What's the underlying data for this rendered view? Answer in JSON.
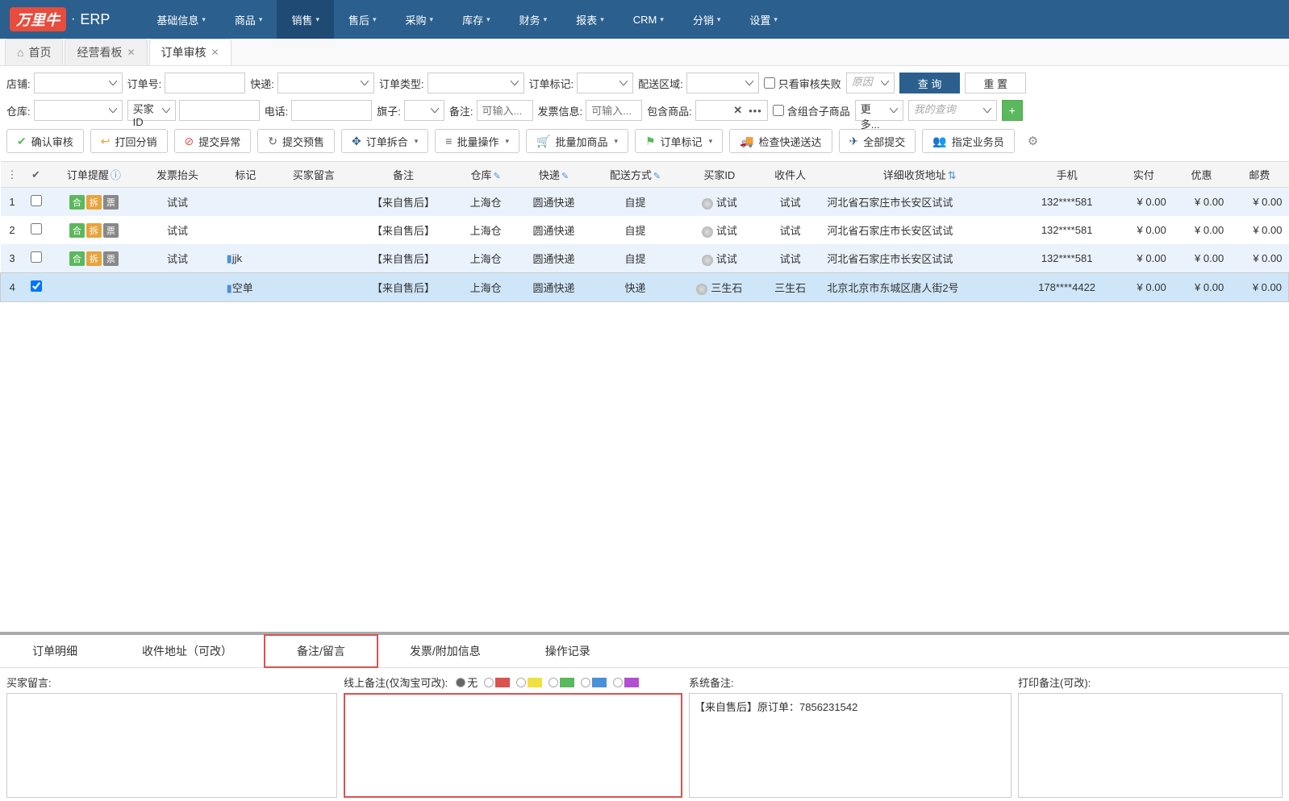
{
  "brand": {
    "logo": "万里牛",
    "suffix": "ERP"
  },
  "nav": [
    "基础信息",
    "商品",
    "销售",
    "售后",
    "采购",
    "库存",
    "财务",
    "报表",
    "CRM",
    "分销",
    "设置"
  ],
  "nav_active_index": 2,
  "tabs": {
    "home": "首页",
    "t1": "经营看板",
    "t2": "订单审核"
  },
  "filters": {
    "row1": {
      "shop": "店铺:",
      "order_no": "订单号:",
      "express": "快递:",
      "order_type": "订单类型:",
      "order_mark": "订单标记:",
      "delivery_area": "配送区域:",
      "only_fail": "只看审核失败",
      "reason_ph": "原因",
      "query": "查 询",
      "reset": "重 置"
    },
    "row2": {
      "warehouse": "仓库:",
      "buyer_id": "买家ID",
      "phone": "电话:",
      "flag": "旗子:",
      "remark": "备注:",
      "remark_ph": "可输入...",
      "invoice": "发票信息:",
      "invoice_ph": "可输入...",
      "include_goods": "包含商品:",
      "combo": "含组合子商品",
      "more": "更 多...",
      "my_query_ph": "我的查询"
    }
  },
  "toolbar": [
    {
      "icon": "✔",
      "cls": "ico-green",
      "label": "确认审核"
    },
    {
      "icon": "↩",
      "cls": "ico-orange",
      "label": "打回分销"
    },
    {
      "icon": "⊘",
      "cls": "ico-red",
      "label": "提交异常"
    },
    {
      "icon": "↻",
      "cls": "ico-gray",
      "label": "提交预售"
    },
    {
      "icon": "✥",
      "cls": "ico-blue",
      "label": "订单拆合",
      "caret": true
    },
    {
      "icon": "≡",
      "cls": "ico-gray",
      "label": "批量操作",
      "caret": true
    },
    {
      "icon": "🛒",
      "cls": "ico-orange",
      "label": "批量加商品",
      "caret": true
    },
    {
      "icon": "⚑",
      "cls": "ico-green",
      "label": "订单标记",
      "caret": true
    },
    {
      "icon": "🚚",
      "cls": "ico-truck",
      "label": "检查快递送达"
    },
    {
      "icon": "✈",
      "cls": "ico-blue",
      "label": "全部提交"
    },
    {
      "icon": "👥",
      "cls": "ico-blue",
      "label": "指定业务员"
    }
  ],
  "columns": {
    "remind": "订单提醒",
    "invoice_title": "发票抬头",
    "mark": "标记",
    "buyer_msg": "买家留言",
    "remark": "备注",
    "warehouse": "仓库",
    "express": "快递",
    "delivery": "配送方式",
    "buyer_id": "买家ID",
    "receiver": "收件人",
    "address": "详细收货地址",
    "phone": "手机",
    "paid": "实付",
    "discount": "优惠",
    "postage": "邮费"
  },
  "rows": [
    {
      "idx": "1",
      "checked": false,
      "tags": [
        "合",
        "拆",
        "票"
      ],
      "title": "试试",
      "mark": "",
      "remark": "【来自售后】",
      "wh": "上海仓",
      "express": "圆通快递",
      "delivery": "自提",
      "bid": "试试",
      "recv": "试试",
      "addr": "河北省石家庄市长安区试试",
      "phone": "132****581",
      "paid": "¥ 0.00",
      "disc": "¥ 0.00",
      "post": "¥ 0.00"
    },
    {
      "idx": "2",
      "checked": false,
      "tags": [
        "合",
        "拆",
        "票"
      ],
      "title": "试试",
      "mark": "",
      "remark": "【来自售后】",
      "wh": "上海仓",
      "express": "圆通快递",
      "delivery": "自提",
      "bid": "试试",
      "recv": "试试",
      "addr": "河北省石家庄市长安区试试",
      "phone": "132****581",
      "paid": "¥ 0.00",
      "disc": "¥ 0.00",
      "post": "¥ 0.00"
    },
    {
      "idx": "3",
      "checked": false,
      "tags": [
        "合",
        "拆",
        "票"
      ],
      "title": "试试",
      "mark": "jjk",
      "remark": "【来自售后】",
      "wh": "上海仓",
      "express": "圆通快递",
      "delivery": "自提",
      "bid": "试试",
      "recv": "试试",
      "addr": "河北省石家庄市长安区试试",
      "phone": "132****581",
      "paid": "¥ 0.00",
      "disc": "¥ 0.00",
      "post": "¥ 0.00"
    },
    {
      "idx": "4",
      "checked": true,
      "tags": [],
      "title": "",
      "mark": "空单",
      "remark": "【来自售后】",
      "wh": "上海仓",
      "express": "圆通快递",
      "delivery": "快递",
      "bid": "三生石",
      "recv": "三生石",
      "addr": "北京北京市东城区唐人街2号",
      "phone": "178****4422",
      "paid": "¥ 0.00",
      "disc": "¥ 0.00",
      "post": "¥ 0.00"
    }
  ],
  "bottom": {
    "tabs": [
      "订单明细",
      "收件地址（可改）",
      "备注/留言",
      "发票/附加信息",
      "操作记录"
    ],
    "active_index": 2,
    "buyer_msg_label": "买家留言:",
    "online_remark_label": "线上备注(仅淘宝可改):",
    "flag_none": "无",
    "flag_colors": [
      "#d9534f",
      "#f0e040",
      "#5cb85c",
      "#4a90d9",
      "#b050d0"
    ],
    "sys_remark_label": "系统备注:",
    "sys_remark_value": "【来自售后】原订单：7856231542",
    "print_remark_label": "打印备注(可改):"
  }
}
